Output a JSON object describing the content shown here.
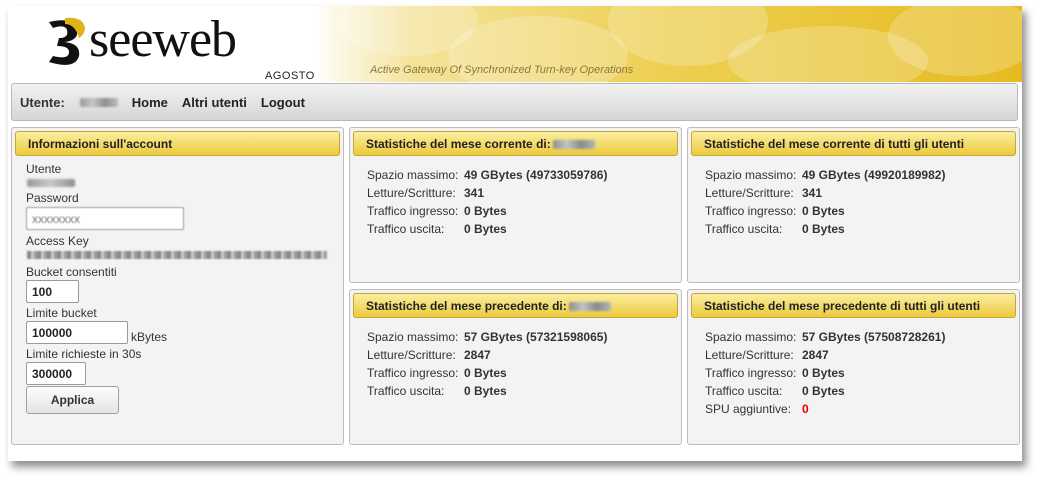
{
  "header": {
    "logo_text": "seeweb",
    "logo_sub": "AGOSTO",
    "tagline": "Active Gateway Of Synchronized Turn-key Operations"
  },
  "nav": {
    "user_label": "Utente:",
    "links": [
      "Home",
      "Altri utenti",
      "Logout"
    ]
  },
  "account": {
    "title": "Informazioni sull'account",
    "user_label": "Utente",
    "password_label": "Password",
    "access_key_label": "Access Key",
    "bucket_label": "Bucket consentiti",
    "bucket_value": "100",
    "limit_bucket_label": "Limite bucket",
    "limit_bucket_value": "100000",
    "limit_bucket_unit": "kBytes",
    "limit_requests_label": "Limite richieste in 30s",
    "limit_requests_value": "300000",
    "apply_label": "Applica"
  },
  "current_user": {
    "title": "Statistiche del mese corrente di:",
    "rows": [
      {
        "label": "Spazio massimo:",
        "value": "49 GBytes (49733059786)"
      },
      {
        "label": "Letture/Scritture:",
        "value": "341"
      },
      {
        "label": "Traffico ingresso:",
        "value": "0 Bytes"
      },
      {
        "label": "Traffico uscita:",
        "value": "0 Bytes"
      }
    ]
  },
  "current_all": {
    "title": "Statistiche del mese corrente di tutti gli utenti",
    "rows": [
      {
        "label": "Spazio massimo:",
        "value": "49 GBytes (49920189982)"
      },
      {
        "label": "Letture/Scritture:",
        "value": "341"
      },
      {
        "label": "Traffico ingresso:",
        "value": "0 Bytes"
      },
      {
        "label": "Traffico uscita:",
        "value": "0 Bytes"
      }
    ]
  },
  "previous_user": {
    "title": "Statistiche del mese precedente di:",
    "rows": [
      {
        "label": "Spazio massimo:",
        "value": "57 GBytes (57321598065)"
      },
      {
        "label": "Letture/Scritture:",
        "value": "2847"
      },
      {
        "label": "Traffico ingresso:",
        "value": "0 Bytes"
      },
      {
        "label": "Traffico uscita:",
        "value": "0 Bytes"
      }
    ]
  },
  "previous_all": {
    "title": "Statistiche del mese precedente di tutti gli utenti",
    "rows": [
      {
        "label": "Spazio massimo:",
        "value": "57 GBytes (57508728261)"
      },
      {
        "label": "Letture/Scritture:",
        "value": "2847"
      },
      {
        "label": "Traffico ingresso:",
        "value": "0 Bytes"
      },
      {
        "label": "Traffico uscita:",
        "value": "0 Bytes"
      },
      {
        "label": "SPU aggiuntive:",
        "value": "0",
        "highlight": "#e00000"
      }
    ]
  }
}
